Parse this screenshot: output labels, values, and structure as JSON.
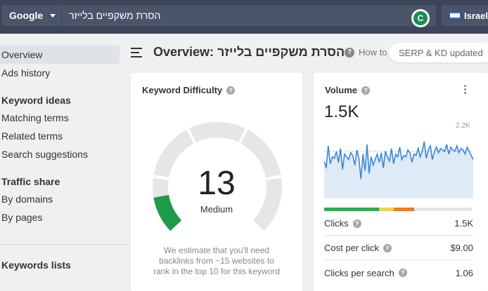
{
  "topbar": {
    "engine": "Google",
    "query": "הסרת משקפיים בלייזר",
    "country": "Israel"
  },
  "sidebar": {
    "overview": "Overview",
    "ads_history": "Ads history",
    "keyword_ideas_heading": "Keyword ideas",
    "matching_terms": "Matching terms",
    "related_terms": "Related terms",
    "search_suggestions": "Search suggestions",
    "traffic_share_heading": "Traffic share",
    "by_domains": "By domains",
    "by_pages": "By pages",
    "keywords_lists_heading": "Keywords lists"
  },
  "header": {
    "title": "Overview: הסרת משקפיים בלייזר",
    "howto": "How to",
    "serp_updated": "SERP & KD updated"
  },
  "kd_card": {
    "title": "Keyword Difficulty",
    "value": "13",
    "label": "Medium",
    "description": "We estimate that you'll need backlinks from ~15 websites to rank in the top 10 for this keyword",
    "fraction": 0.13
  },
  "volume_card": {
    "title": "Volume",
    "value": "1.5K",
    "chart_max": "2.2K",
    "clicks_label": "Clicks",
    "clicks_value": "1.5K",
    "cpc_label": "Cost per click",
    "cpc_value": "$9.00",
    "cps_label": "Clicks per search",
    "cps_value": "1.06"
  },
  "colors": {
    "topbar": "#3c4559",
    "accent_blue": "#3a87d6",
    "kd_green": "#1f9a4a",
    "organic": "#2fa84f",
    "paid_yellow": "#f3d14a",
    "paid_orange": "#f07a1e"
  },
  "chart_data": {
    "type": "line",
    "title": "",
    "y_max_label": "2.2K",
    "ylim": [
      0,
      2200
    ],
    "series": [
      {
        "values": [
          1350,
          1100,
          1900,
          1250,
          1500,
          1450,
          1700,
          1300,
          1800,
          1050,
          1600,
          1500,
          1400,
          1650,
          1550,
          1200,
          1750,
          1450,
          700,
          1600,
          1000,
          1950,
          900,
          1500,
          1200,
          1400,
          1600,
          1300,
          1650,
          1100,
          1700,
          1500,
          1350,
          1800,
          1250,
          1600,
          1500,
          1850,
          1400,
          1550,
          1500,
          1750,
          1650,
          1300,
          1600,
          1550,
          1800,
          1500,
          1700,
          2050,
          1450,
          1750,
          1900,
          1400,
          1700,
          1850,
          1650,
          1800,
          1750,
          1700,
          1950,
          1600,
          1850,
          1750,
          1700,
          1900,
          1650,
          1800,
          1750,
          1600,
          1850,
          1700,
          1550,
          1400
        ]
      }
    ],
    "dashed_line_value": 1700,
    "traffic_split": [
      {
        "name": "organic",
        "fraction": 0.37
      },
      {
        "name": "paid-yellow",
        "fraction": 0.1
      },
      {
        "name": "paid-orange",
        "fraction": 0.14
      },
      {
        "name": "no-clicks",
        "fraction": 0.39
      }
    ]
  }
}
